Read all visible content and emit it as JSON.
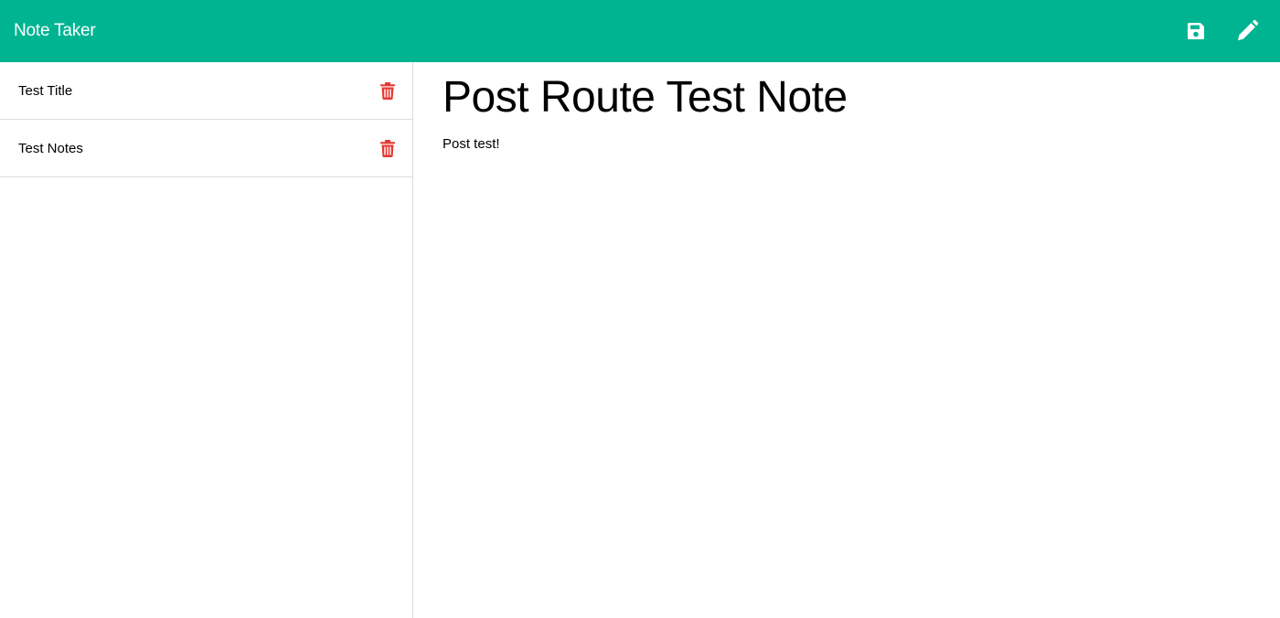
{
  "navbar": {
    "brand": "Note Taker",
    "save_icon": "save-icon",
    "new_note_icon": "pencil-icon",
    "background": "#00b492",
    "icon_color": "#ffffff"
  },
  "sidebar": {
    "notes": [
      {
        "title": "Test Title"
      },
      {
        "title": "Test Notes"
      }
    ],
    "delete_icon": "trash-icon",
    "delete_color": "#e53935"
  },
  "main": {
    "title": "Post Route Test Note",
    "text": "Post test!"
  }
}
